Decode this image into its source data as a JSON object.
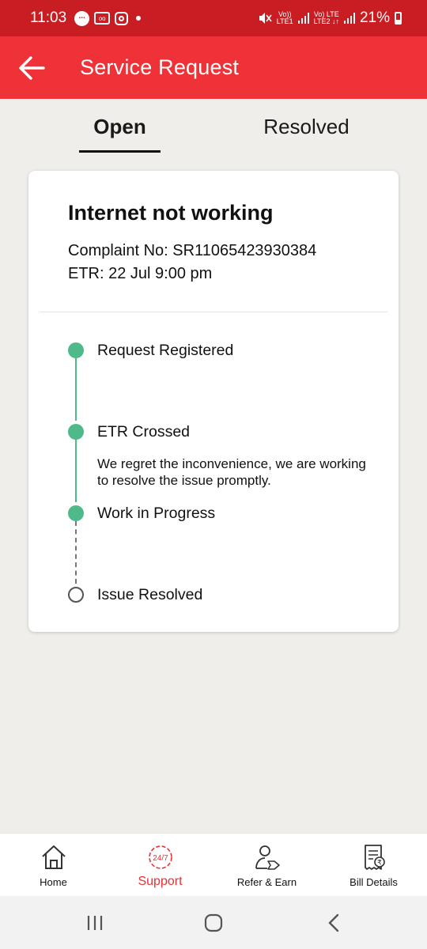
{
  "status_bar": {
    "time": "11:03",
    "net1": "Vo))",
    "net1_sub": "LTE1",
    "net2": "Vo) LTE",
    "net2_sub": "LTE2 ↓↑",
    "battery": "21%"
  },
  "header": {
    "title": "Service Request",
    "back_icon": "arrow-left-icon"
  },
  "tabs": {
    "open": "Open",
    "resolved": "Resolved",
    "active": "open"
  },
  "request": {
    "title": "Internet not working",
    "complaint_no": "Complaint No: SR11065423930384",
    "etr": "ETR: 22 Jul 9:00 pm",
    "timeline": [
      {
        "label": "Request Registered",
        "status": "completed"
      },
      {
        "label": "ETR Crossed",
        "description": "We regret the inconvenience, we are working to resolve the issue promptly.",
        "status": "completed"
      },
      {
        "label": "Work in Progress",
        "status": "completed"
      },
      {
        "label": "Issue Resolved",
        "status": "pending"
      }
    ]
  },
  "bottom_nav": {
    "items": [
      {
        "label": "Home",
        "icon": "home-icon"
      },
      {
        "label": "Support",
        "icon": "support-24-7-icon",
        "badge": "24/7",
        "active": true
      },
      {
        "label": "Refer & Earn",
        "icon": "refer-earn-icon"
      },
      {
        "label": "Bill Details",
        "icon": "bill-details-icon"
      }
    ]
  },
  "colors": {
    "header": "#ee3237",
    "status_bar": "#c81e23",
    "timeline_green": "#4fb98a",
    "active_nav": "#e53238"
  }
}
